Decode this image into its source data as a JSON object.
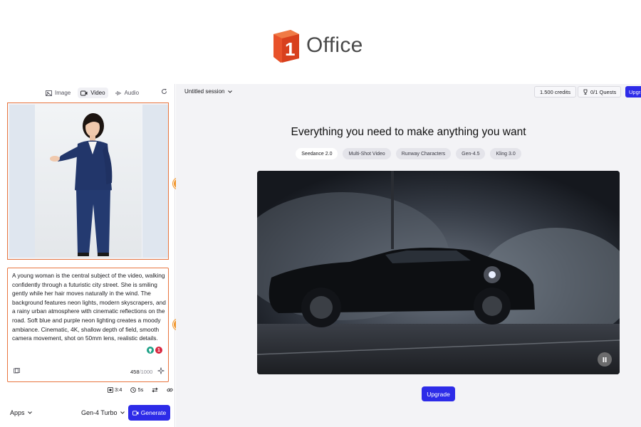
{
  "logo": {
    "text": "Office",
    "mark": "1",
    "colors": {
      "brand": "#e8522a",
      "text": "#4a4a4a"
    }
  },
  "left_panel": {
    "mode_tabs": [
      {
        "label": "Image",
        "icon": "image-icon",
        "active": false
      },
      {
        "label": "Video",
        "icon": "video-icon",
        "active": true
      },
      {
        "label": "Audio",
        "icon": "audio-icon",
        "active": false
      }
    ],
    "prompt": {
      "text": "A young woman is the central subject of the video, walking confidently through a futuristic city street. She is smiling gently while her hair moves naturally in the wind. The background features neon lights, modern skyscrapers, and a rainy urban atmosphere with cinematic reflections on the road. Soft blue and purple neon lighting creates a moody ambiance. Cinematic, 4K, shallow depth of field, smooth camera movement, shot on 50mm lens, realistic details.",
      "char_count": "458",
      "char_max": "/1000",
      "indicator_count": "1"
    },
    "settings": {
      "ratio": "3:4",
      "duration": "5s"
    },
    "apps_label": "Apps",
    "model_label": "Gen-4 Turbo",
    "generate_label": "Generate"
  },
  "callouts": {
    "first": "1",
    "second": "2"
  },
  "right_panel": {
    "session_title": "Untitled session",
    "credits": "1.500 credits",
    "quests": "0/1 Quests",
    "upgrade_top": "Upgrade",
    "headline": "Everything you need to make anything you want",
    "model_tabs": [
      {
        "label": "Seedance 2.0",
        "active": true
      },
      {
        "label": "Multi-Shot Video",
        "active": false
      },
      {
        "label": "Runway Characters",
        "active": false
      },
      {
        "label": "Gen-4.5",
        "active": false
      },
      {
        "label": "Kling 3.0",
        "active": false
      }
    ],
    "upgrade_main": "Upgrade",
    "accent_color": "#2d2be8"
  }
}
